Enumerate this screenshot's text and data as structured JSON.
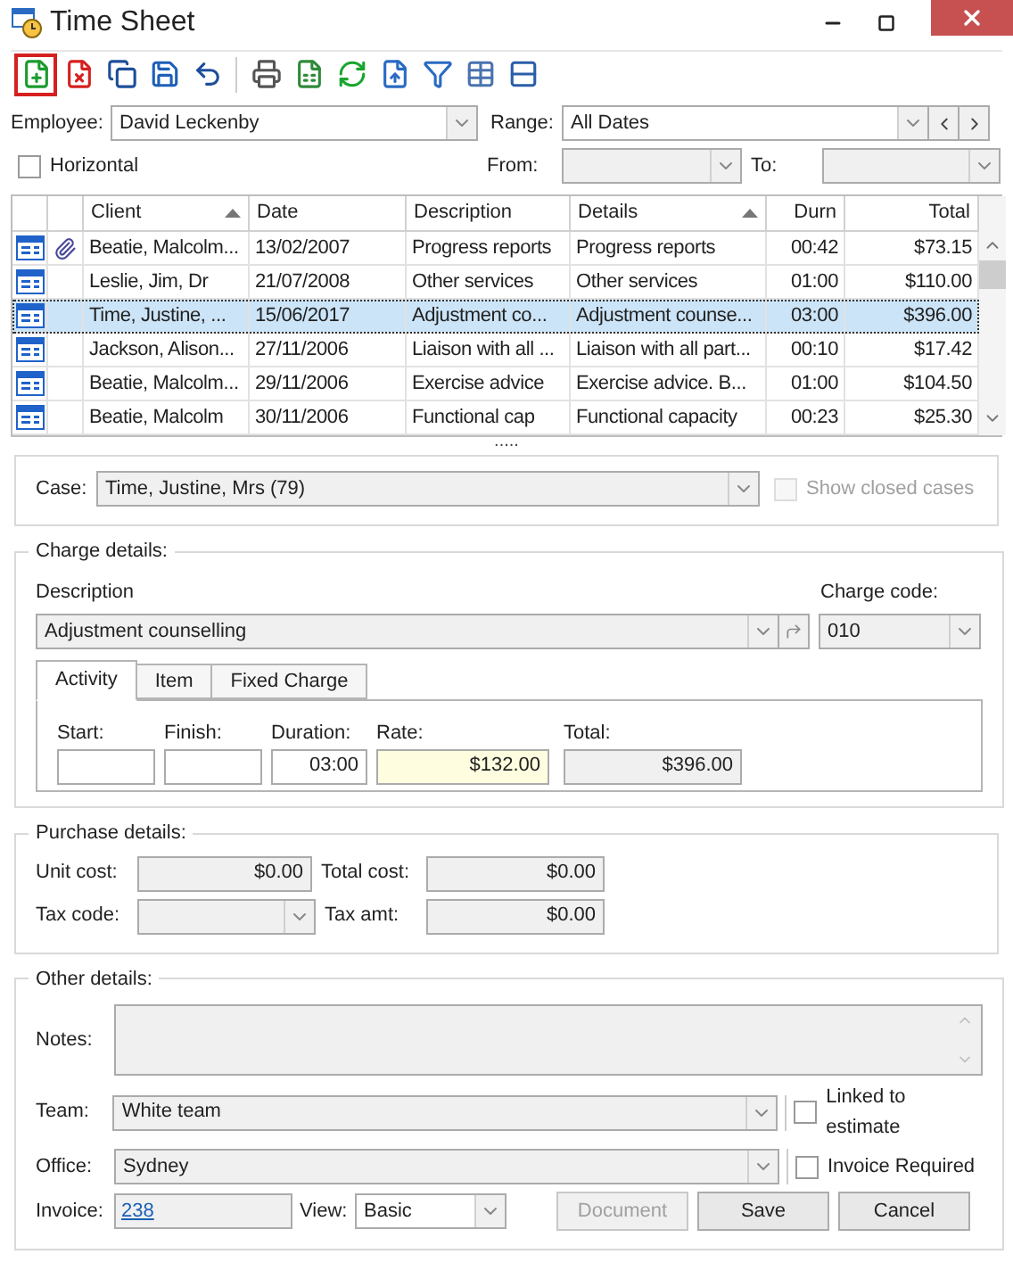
{
  "window": {
    "title": "Time Sheet"
  },
  "toolbar": {
    "groups": [
      [
        {
          "kind": "new",
          "selected": true
        },
        {
          "kind": "delete",
          "selected": false
        },
        {
          "kind": "copy",
          "selected": false
        },
        {
          "kind": "save",
          "selected": false
        },
        {
          "kind": "undo",
          "selected": false
        }
      ],
      [
        {
          "kind": "print",
          "selected": false
        },
        {
          "kind": "export",
          "selected": false
        },
        {
          "kind": "refresh",
          "selected": false
        },
        {
          "kind": "import",
          "selected": false
        },
        {
          "kind": "filter",
          "selected": false
        },
        {
          "kind": "grid",
          "selected": false
        },
        {
          "kind": "layout",
          "selected": false
        }
      ]
    ]
  },
  "filters": {
    "employee_label": "Employee:",
    "employee": "David Leckenby",
    "range_label": "Range:",
    "range": "All Dates",
    "horizontal": {
      "label": "Horizontal",
      "checked": false
    },
    "from_label": "From:",
    "to_label": "To:"
  },
  "table": {
    "columns": [
      {
        "label": "Client",
        "sorted": true
      },
      {
        "label": "Date",
        "sorted": false
      },
      {
        "label": "Description",
        "sorted": false
      },
      {
        "label": "Details",
        "sorted": true
      },
      {
        "label": "Durn",
        "sorted": false
      },
      {
        "label": "Total",
        "sorted": false
      }
    ],
    "rows": [
      {
        "attachment": true,
        "selected": false,
        "cells": [
          "Beatie, Malcolm...",
          "13/02/2007",
          "Progress reports",
          "Progress reports",
          "00:42",
          "$73.15"
        ]
      },
      {
        "attachment": false,
        "selected": false,
        "cells": [
          "Leslie, Jim, Dr",
          "21/07/2008",
          "Other services",
          "Other services",
          "01:00",
          "$110.00"
        ]
      },
      {
        "attachment": false,
        "selected": true,
        "cells": [
          "Time, Justine, ...",
          "15/06/2017",
          "Adjustment co...",
          "Adjustment counse...",
          "03:00",
          "$396.00"
        ]
      },
      {
        "attachment": false,
        "selected": false,
        "cells": [
          "Jackson, Alison...",
          "27/11/2006",
          "Liaison with all ...",
          "Liaison with all part...",
          "00:10",
          "$17.42"
        ]
      },
      {
        "attachment": false,
        "selected": false,
        "cells": [
          "Beatie, Malcolm...",
          "29/11/2006",
          "Exercise advice",
          "Exercise advice. B...",
          "01:00",
          "$104.50"
        ]
      },
      {
        "attachment": false,
        "selected": false,
        "cells": [
          "Beatie, Malcolm",
          "30/11/2006",
          "Functional cap",
          "Functional capacity",
          "00:23",
          "$25.30"
        ]
      }
    ]
  },
  "splitter": ".....",
  "case": {
    "label": "Case:",
    "value": "Time, Justine, Mrs (79)",
    "show_closed": {
      "label": "Show closed cases",
      "checked": false,
      "disabled": true
    }
  },
  "charge": {
    "legend": "Charge details:",
    "description_label": "Description",
    "description": "Adjustment counselling",
    "code_label": "Charge code:",
    "code": "010",
    "tabs": [
      {
        "label": "Activity",
        "selected": true
      },
      {
        "label": "Item",
        "selected": false
      },
      {
        "label": "Fixed Charge",
        "selected": false
      }
    ],
    "fields": [
      {
        "label": "Start:",
        "kind": "plain"
      },
      {
        "label": "Finish:",
        "kind": "plain"
      },
      {
        "label": "Duration:",
        "value": "03:00",
        "kind": "plain"
      },
      {
        "label": "Rate:",
        "value": "$132.00",
        "kind": "highlight"
      },
      {
        "label": "Total:",
        "value": "$396.00",
        "kind": "readonly"
      }
    ]
  },
  "purchase": {
    "legend": "Purchase details:",
    "unit_cost_label": "Unit cost:",
    "unit_cost": "$0.00",
    "total_cost_label": "Total cost:",
    "total_cost": "$0.00",
    "tax_code_label": "Tax code:",
    "tax_amt_label": "Tax amt:",
    "tax_amt": "$0.00"
  },
  "other": {
    "legend": "Other details:",
    "notes_label": "Notes:",
    "team_label": "Team:",
    "team": "White team",
    "office_label": "Office:",
    "office": "Sydney",
    "linked": {
      "label": "Linked to estimate",
      "checked": false
    },
    "invoice_required": {
      "label": "Invoice Required",
      "checked": false
    },
    "invoice_label": "Invoice:",
    "invoice": "238",
    "view_label": "View:",
    "view": "Basic",
    "buttons": [
      {
        "label": "Document",
        "disabled": true
      },
      {
        "label": "Save",
        "disabled": false
      },
      {
        "label": "Cancel",
        "disabled": false
      }
    ]
  }
}
